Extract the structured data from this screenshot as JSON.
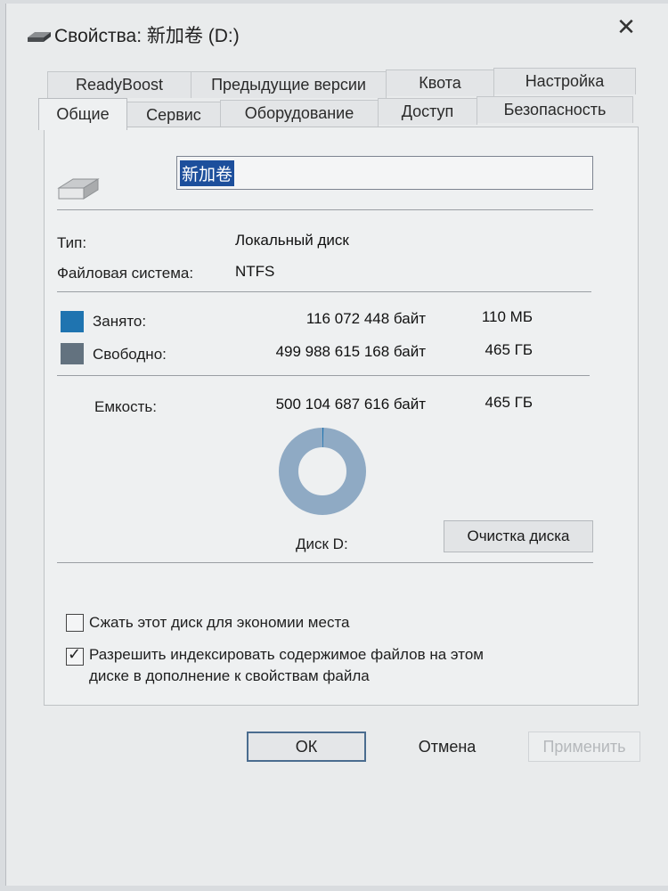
{
  "window": {
    "title": "Свойства: 新加卷 (D:)"
  },
  "tabs_back": [
    {
      "label": "ReadyBoost"
    },
    {
      "label": "Предыдущие версии"
    },
    {
      "label": "Квота"
    },
    {
      "label": "Настройка"
    }
  ],
  "tabs_front": [
    {
      "label": "Общие"
    },
    {
      "label": "Сервис"
    },
    {
      "label": "Оборудование"
    },
    {
      "label": "Доступ"
    },
    {
      "label": "Безопасность"
    }
  ],
  "general": {
    "volume_name": "新加卷",
    "type_label": "Тип:",
    "type_value": "Локальный диск",
    "fs_label": "Файловая система:",
    "fs_value": "NTFS",
    "used_label": "Занято:",
    "used_bytes": "116 072 448 байт",
    "used_size": "110 МБ",
    "free_label": "Свободно:",
    "free_bytes": "499 988 615 168 байт",
    "free_size": "465 ГБ",
    "capacity_label": "Емкость:",
    "capacity_bytes": "500 104 687 616 байт",
    "capacity_size": "465 ГБ",
    "disk_label": "Диск D:",
    "cleanup_button": "Очистка диска",
    "used_fraction": 0.00023
  },
  "options": {
    "compress_label": "Сжать этот диск для экономии места",
    "compress_checked": false,
    "index_label_line1": "Разрешить индексировать содержимое файлов на этом",
    "index_label_line2": "диске в дополнение к свойствам файла",
    "index_checked": true
  },
  "buttons": {
    "ok": "ОК",
    "cancel": "Отмена",
    "apply": "Применить"
  },
  "colors": {
    "used": "#1f74b0",
    "free": "#63727f",
    "donut_ring": "#8faac4"
  }
}
